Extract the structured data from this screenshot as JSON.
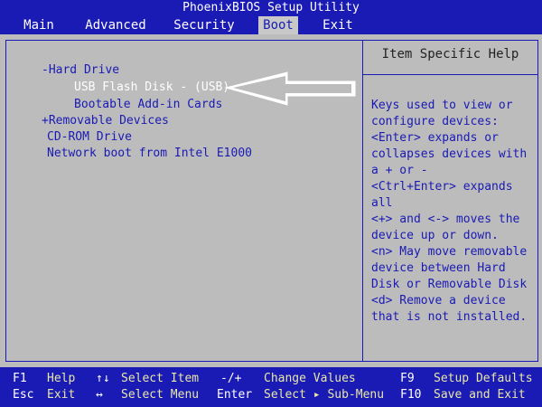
{
  "app": {
    "title": "PhoenixBIOS Setup Utility"
  },
  "menu": [
    {
      "label": "Main"
    },
    {
      "label": "Advanced"
    },
    {
      "label": "Security"
    },
    {
      "label": "Boot"
    },
    {
      "label": "Exit"
    }
  ],
  "active_menu": "Boot",
  "boot": {
    "items": [
      {
        "label": "-Hard Drive"
      },
      {
        "label": "USB Flash Disk - (USB)"
      },
      {
        "label": "Bootable Add-in Cards"
      },
      {
        "label": "+Removable Devices"
      },
      {
        "label": "CD-ROM Drive"
      },
      {
        "label": "Network boot from Intel E1000"
      }
    ],
    "selected_item": "USB Flash Disk - (USB)"
  },
  "help": {
    "title": "Item Specific Help",
    "lines": [
      "Keys used to view or",
      "configure devices:",
      "<Enter> expands or",
      "collapses devices with",
      "a + or -",
      "<Ctrl+Enter> expands",
      "all",
      "<+> and <-> moves the",
      "device up or down.",
      "<n> May move removable",
      "device between Hard",
      "Disk or Removable Disk",
      "<d> Remove a device",
      "that is not installed."
    ]
  },
  "footer": {
    "row1": [
      {
        "key": "F1",
        "desc": "Help"
      },
      {
        "key": "↑↓",
        "desc": "Select Item"
      },
      {
        "key": "-/+",
        "desc": "Change Values"
      },
      {
        "key": "F9",
        "desc": "Setup Defaults"
      }
    ],
    "row2": [
      {
        "key": "Esc",
        "desc": "Exit"
      },
      {
        "key": "↔",
        "desc": "Select Menu"
      },
      {
        "key": "Enter",
        "desc": "Select ▸ Sub-Menu"
      },
      {
        "key": "F10",
        "desc": "Save and Exit"
      }
    ]
  },
  "colors": {
    "blue": "#1a1ab4",
    "gray": "#bcbcbc",
    "white": "#ffffff"
  }
}
